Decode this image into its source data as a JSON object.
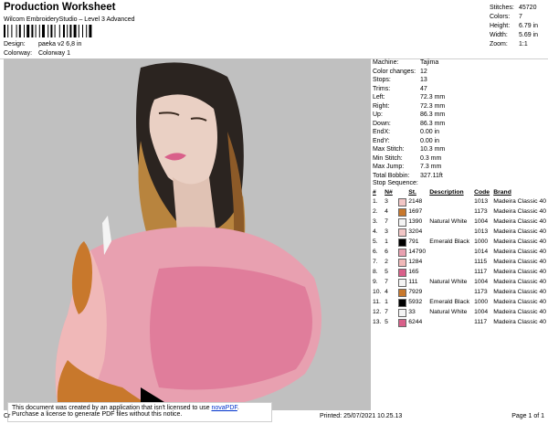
{
  "header": {
    "title": "Production Worksheet",
    "subtitle": "Wilcom EmbroideryStudio – Level 3 Advanced",
    "design_label": "Design:",
    "design_value": "paeka v2 6,8 in",
    "colorway_label": "Colorway:",
    "colorway_value": "Colorway 1"
  },
  "summary": [
    {
      "label": "Stitches:",
      "value": "45720"
    },
    {
      "label": "Colors:",
      "value": "7"
    },
    {
      "label": "Height:",
      "value": "6.79 in"
    },
    {
      "label": "Width:",
      "value": "5.69 in"
    },
    {
      "label": "Zoom:",
      "value": "1:1"
    }
  ],
  "machine_info": [
    {
      "label": "Machine:",
      "value": "Tajima"
    },
    {
      "label": "Color changes:",
      "value": "12"
    },
    {
      "label": "Stops:",
      "value": "13"
    },
    {
      "label": "Trims:",
      "value": "47"
    },
    {
      "label": "Left:",
      "value": "72.3 mm"
    },
    {
      "label": "Right:",
      "value": "72.3 mm"
    },
    {
      "label": "Up:",
      "value": "86.3 mm"
    },
    {
      "label": "Down:",
      "value": "86.3 mm"
    },
    {
      "label": "EndX:",
      "value": "0.00 in"
    },
    {
      "label": "EndY:",
      "value": "0.00 in"
    },
    {
      "label": "Max Stitch:",
      "value": "10.3 mm"
    },
    {
      "label": "Min Stitch:",
      "value": "0.3 mm"
    },
    {
      "label": "Max Jump:",
      "value": "7.3 mm"
    },
    {
      "label": "Total Bobbin:",
      "value": "327.11ft"
    }
  ],
  "stop_sequence": {
    "title": "Stop Sequence:",
    "headers": [
      "#",
      "N#",
      "",
      "St.",
      "Description",
      "Code",
      "Brand"
    ],
    "rows": [
      {
        "num": "1.",
        "n": "3",
        "color": "#f2c6c6",
        "st": "2148",
        "desc": "",
        "code": "1013",
        "brand": "Madeira Classic 40"
      },
      {
        "num": "2.",
        "n": "4",
        "color": "#c8782c",
        "st": "1697",
        "desc": "",
        "code": "1173",
        "brand": "Madeira Classic 40"
      },
      {
        "num": "3.",
        "n": "7",
        "color": "#f4f4f4",
        "st": "1390",
        "desc": "Natural White",
        "code": "1004",
        "brand": "Madeira Classic 40"
      },
      {
        "num": "4.",
        "n": "3",
        "color": "#f2c6c6",
        "st": "3204",
        "desc": "",
        "code": "1013",
        "brand": "Madeira Classic 40"
      },
      {
        "num": "5.",
        "n": "1",
        "color": "#000000",
        "st": "791",
        "desc": "Emerald Black",
        "code": "1000",
        "brand": "Madeira Classic 40"
      },
      {
        "num": "6.",
        "n": "6",
        "color": "#e8a0b0",
        "st": "14790",
        "desc": "",
        "code": "1014",
        "brand": "Madeira Classic 40"
      },
      {
        "num": "7.",
        "n": "2",
        "color": "#f0b8b8",
        "st": "1284",
        "desc": "",
        "code": "1115",
        "brand": "Madeira Classic 40"
      },
      {
        "num": "8.",
        "n": "5",
        "color": "#d9608a",
        "st": "165",
        "desc": "",
        "code": "1117",
        "brand": "Madeira Classic 40"
      },
      {
        "num": "9.",
        "n": "7",
        "color": "#f4f4f4",
        "st": "111",
        "desc": "Natural White",
        "code": "1004",
        "brand": "Madeira Classic 40"
      },
      {
        "num": "10.",
        "n": "4",
        "color": "#c8782c",
        "st": "7929",
        "desc": "",
        "code": "1173",
        "brand": "Madeira Classic 40"
      },
      {
        "num": "11.",
        "n": "1",
        "color": "#000000",
        "st": "5932",
        "desc": "Emerald Black",
        "code": "1000",
        "brand": "Madeira Classic 40"
      },
      {
        "num": "12.",
        "n": "7",
        "color": "#f4f4f4",
        "st": "33",
        "desc": "Natural White",
        "code": "1004",
        "brand": "Madeira Classic 40"
      },
      {
        "num": "13.",
        "n": "5",
        "color": "#d9608a",
        "st": "6244",
        "desc": "",
        "code": "1117",
        "brand": "Madeira Classic 40"
      }
    ]
  },
  "notice": {
    "line1_prefix": "This document was created by an application that isn't licensed to use ",
    "link": "novaPDF",
    "line1_suffix": ".",
    "line2": "Purchase a license to generate PDF files without this notice."
  },
  "footer": {
    "left": "Cr",
    "printed": "Printed: 25/07/2021 10.25.13",
    "page": "Page 1 of 1"
  },
  "colors": {
    "design_background": "#c0c0c0",
    "hair_dark": "#2b2420",
    "hair_light": "#b8843e",
    "skin": "#ead0c4",
    "shirt_pink": "#e8a0b0",
    "shirt_deep": "#d9608a",
    "lips": "#d9608a"
  }
}
